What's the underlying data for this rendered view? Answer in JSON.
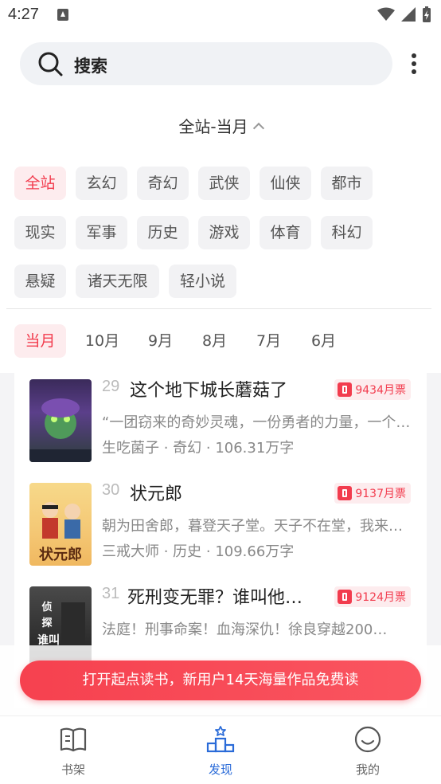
{
  "status_bar": {
    "time": "4:27"
  },
  "search": {
    "label": "搜索"
  },
  "range_title": "全站-当月",
  "categories": [
    "全站",
    "玄幻",
    "奇幻",
    "武侠",
    "仙侠",
    "都市",
    "现实",
    "军事",
    "历史",
    "游戏",
    "体育",
    "科幻",
    "悬疑",
    "诸天无限",
    "轻小说"
  ],
  "active_category": "全站",
  "months": [
    "当月",
    "10月",
    "9月",
    "8月",
    "7月",
    "6月"
  ],
  "active_month": "当月",
  "books": [
    {
      "rank": "29",
      "title": "这个地下城长蘑菇了",
      "votes": "9434月票",
      "desc": "“一团窃来的奇妙灵魂，一份勇者的力量，一个…",
      "meta": "生吃菌子 · 奇幻 · 106.31万字",
      "cover_text": "这个地下城长蘑菇了"
    },
    {
      "rank": "30",
      "title": "状元郎",
      "votes": "9137月票",
      "desc": "朝为田舍郎，暮登天子堂。天子不在堂，我来…",
      "meta": "三戒大师 · 历史 · 109.66万字",
      "cover_text": "状元郎"
    },
    {
      "rank": "31",
      "title": "死刑变无罪？谁叫他…",
      "votes": "9124月票",
      "desc": "法庭！刑事命案！血海深仇！徐良穿越200…",
      "meta": "",
      "cover_text": "谁叫的"
    }
  ],
  "promo": "打开起点读书，新用户14天海量作品免费读",
  "tabs": [
    "书架",
    "发现",
    "我的"
  ],
  "colors": {
    "accent_red": "#f23c4e",
    "accent_blue": "#2a6bd8"
  }
}
